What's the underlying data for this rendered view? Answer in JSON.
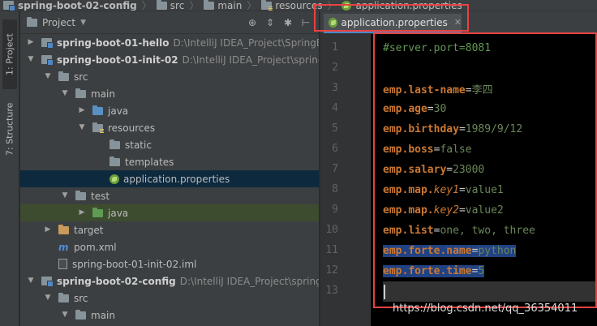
{
  "breadcrumb": [
    {
      "label": "spring-boot-02-config",
      "icon": "module-folder"
    },
    {
      "label": "src",
      "icon": "folder"
    },
    {
      "label": "main",
      "icon": "folder"
    },
    {
      "label": "resources",
      "icon": "resources-folder"
    },
    {
      "label": "application.properties",
      "icon": "spring-leaf"
    }
  ],
  "sidebar": {
    "project_tab": "1: Project",
    "structure_tab": "7: Structure"
  },
  "panel": {
    "title": "Project",
    "tools": [
      "globe-target-icon",
      "collapse-icon",
      "gear-icon",
      "hide-icon"
    ]
  },
  "tree": [
    {
      "label": "spring-boot-01-hello",
      "path": "D:\\IntelliJ IDEA_Project\\SpringBoot",
      "level": 0,
      "expanded": false,
      "icon": "module",
      "bold": true
    },
    {
      "label": "spring-boot-01-init-02",
      "path": "D:\\IntelliJ IDEA_Project\\spring-b",
      "level": 0,
      "expanded": true,
      "icon": "module",
      "bold": true
    },
    {
      "label": "src",
      "level": 1,
      "expanded": true,
      "icon": "folder"
    },
    {
      "label": "main",
      "level": 2,
      "expanded": true,
      "icon": "folder"
    },
    {
      "label": "java",
      "level": 3,
      "expanded": false,
      "icon": "java-folder"
    },
    {
      "label": "resources",
      "level": 3,
      "expanded": true,
      "icon": "resources-folder"
    },
    {
      "label": "static",
      "level": 4,
      "icon": "folder"
    },
    {
      "label": "templates",
      "level": 4,
      "icon": "folder"
    },
    {
      "label": "application.properties",
      "level": 4,
      "icon": "spring-leaf",
      "selected": true
    },
    {
      "label": "test",
      "level": 2,
      "expanded": true,
      "icon": "folder"
    },
    {
      "label": "java",
      "level": 3,
      "expanded": false,
      "icon": "test-java-folder",
      "highlight": true
    },
    {
      "label": "target",
      "level": 1,
      "expanded": false,
      "icon": "target-folder"
    },
    {
      "label": "pom.xml",
      "level": 1,
      "icon": "maven"
    },
    {
      "label": "spring-boot-01-init-02.iml",
      "level": 1,
      "icon": "iml"
    },
    {
      "label": "spring-boot-02-config",
      "path": "D:\\IntelliJ IDEA_Project\\spring-b",
      "level": 0,
      "expanded": true,
      "icon": "module",
      "bold": true
    },
    {
      "label": "src",
      "level": 1,
      "expanded": true,
      "icon": "folder"
    },
    {
      "label": "main",
      "level": 2,
      "expanded": true,
      "icon": "folder"
    }
  ],
  "editor": {
    "tab_label": "application.properties",
    "lines": [
      {
        "n": "1",
        "comment": "#server.port=8081"
      },
      {
        "n": "2"
      },
      {
        "n": "3",
        "parts": [
          {
            "t": "emp",
            "c": "key"
          },
          {
            "t": ".",
            "c": "dot"
          },
          {
            "t": "last-name",
            "c": "key"
          },
          {
            "t": "=",
            "c": "eq"
          },
          {
            "t": "李四",
            "c": "val"
          }
        ]
      },
      {
        "n": "4",
        "parts": [
          {
            "t": "emp",
            "c": "key"
          },
          {
            "t": ".",
            "c": "dot"
          },
          {
            "t": "age",
            "c": "key"
          },
          {
            "t": "=",
            "c": "eq"
          },
          {
            "t": "30",
            "c": "val"
          }
        ]
      },
      {
        "n": "5",
        "parts": [
          {
            "t": "emp",
            "c": "key"
          },
          {
            "t": ".",
            "c": "dot"
          },
          {
            "t": "birthday",
            "c": "key"
          },
          {
            "t": "=",
            "c": "eq"
          },
          {
            "t": "1989/9/12",
            "c": "val"
          }
        ]
      },
      {
        "n": "6",
        "parts": [
          {
            "t": "emp",
            "c": "key"
          },
          {
            "t": ".",
            "c": "dot"
          },
          {
            "t": "boss",
            "c": "key"
          },
          {
            "t": "=",
            "c": "eq"
          },
          {
            "t": "false",
            "c": "val"
          }
        ]
      },
      {
        "n": "7",
        "parts": [
          {
            "t": "emp",
            "c": "key"
          },
          {
            "t": ".",
            "c": "dot"
          },
          {
            "t": "salary",
            "c": "key"
          },
          {
            "t": "=",
            "c": "eq"
          },
          {
            "t": "23000",
            "c": "val"
          }
        ]
      },
      {
        "n": "8",
        "parts": [
          {
            "t": "emp",
            "c": "key"
          },
          {
            "t": ".",
            "c": "dot"
          },
          {
            "t": "map",
            "c": "key"
          },
          {
            "t": ".",
            "c": "dot"
          },
          {
            "t": "key1",
            "c": "ital"
          },
          {
            "t": "=",
            "c": "eq"
          },
          {
            "t": "value1",
            "c": "val"
          }
        ]
      },
      {
        "n": "9",
        "parts": [
          {
            "t": "emp",
            "c": "key"
          },
          {
            "t": ".",
            "c": "dot"
          },
          {
            "t": "map",
            "c": "key"
          },
          {
            "t": ".",
            "c": "dot"
          },
          {
            "t": "key2",
            "c": "ital"
          },
          {
            "t": "=",
            "c": "eq"
          },
          {
            "t": "value2",
            "c": "val"
          }
        ]
      },
      {
        "n": "10",
        "parts": [
          {
            "t": "emp",
            "c": "key"
          },
          {
            "t": ".",
            "c": "dot"
          },
          {
            "t": "list",
            "c": "key"
          },
          {
            "t": "=",
            "c": "eq"
          },
          {
            "t": "one, two, three",
            "c": "val"
          }
        ]
      },
      {
        "n": "11",
        "selected": true,
        "parts": [
          {
            "t": "emp",
            "c": "key"
          },
          {
            "t": ".",
            "c": "dot"
          },
          {
            "t": "forte",
            "c": "key"
          },
          {
            "t": ".",
            "c": "dot"
          },
          {
            "t": "name",
            "c": "key"
          },
          {
            "t": "=",
            "c": "eq"
          },
          {
            "t": "python",
            "c": "val"
          }
        ]
      },
      {
        "n": "12",
        "selected": true,
        "parts": [
          {
            "t": "emp",
            "c": "key"
          },
          {
            "t": ".",
            "c": "dot"
          },
          {
            "t": "forte",
            "c": "key"
          },
          {
            "t": ".",
            "c": "dot"
          },
          {
            "t": "time",
            "c": "key"
          },
          {
            "t": "=",
            "c": "eq"
          },
          {
            "t": "5",
            "c": "val"
          }
        ]
      },
      {
        "n": "13",
        "caret": true
      }
    ]
  },
  "watermark": "https://blog.csdn.net/qq_36354011",
  "colors": {
    "key": "#cc7832",
    "value": "#6a8759",
    "comment": "#629755",
    "annotation_outline": "#e84242",
    "selection": "#214283"
  }
}
